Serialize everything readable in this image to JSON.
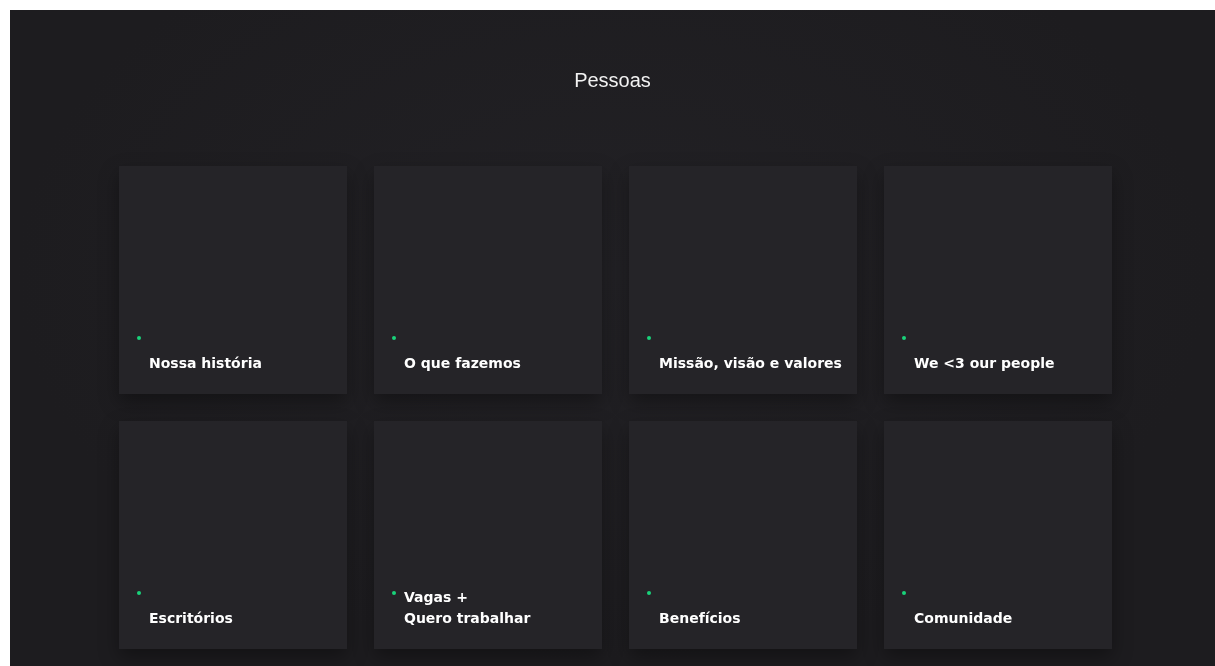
{
  "title": "Pessoas",
  "cards": [
    {
      "label": "Nossa história"
    },
    {
      "label": "O que fazemos"
    },
    {
      "label": "Missão, visão e valores"
    },
    {
      "label": "We <3 our people"
    },
    {
      "label": "Escritórios"
    },
    {
      "label": "Vagas +\nQuero trabalhar"
    },
    {
      "label": "Benefícios"
    },
    {
      "label": "Comunidade"
    }
  ]
}
